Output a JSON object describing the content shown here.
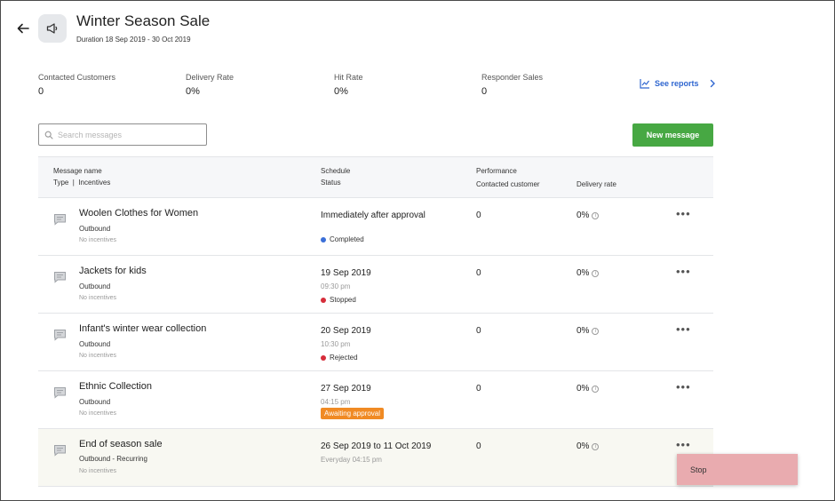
{
  "campaign": {
    "title": "Winter Season Sale",
    "duration": "Duration 18 Sep 2019 - 30 Oct 2019"
  },
  "stats": [
    {
      "label": "Contacted Customers",
      "value": "0"
    },
    {
      "label": "Delivery Rate",
      "value": "0%"
    },
    {
      "label": "Hit Rate",
      "value": "0%"
    },
    {
      "label": "Responder Sales",
      "value": "0"
    }
  ],
  "reports_link": "See reports",
  "search": {
    "placeholder": "Search messages",
    "value": ""
  },
  "new_message_label": "New message",
  "table": {
    "headers": {
      "message_name": "Message name",
      "type_incentives": "Type  |  Incentives",
      "schedule": "Schedule",
      "status": "Status",
      "performance": "Performance",
      "contacted": "Contacted customer",
      "delivery_rate": "Delivery rate"
    },
    "rows": [
      {
        "name": "Woolen Clothes for Women",
        "type": "Outbound",
        "incentives": "No incentives",
        "schedule": "Immediately after approval",
        "time": "",
        "status": "Completed",
        "contacted": "0",
        "rate": "0%"
      },
      {
        "name": "Jackets for kids",
        "type": "Outbound",
        "incentives": "No incentives",
        "schedule": "19 Sep 2019",
        "time": "09:30 pm",
        "status": "Stopped",
        "contacted": "0",
        "rate": "0%"
      },
      {
        "name": "Infant's winter wear collection",
        "type": "Outbound",
        "incentives": "No incentives",
        "schedule": "20 Sep 2019",
        "time": "10:30 pm",
        "status": "Rejected",
        "contacted": "0",
        "rate": "0%"
      },
      {
        "name": "Ethnic Collection",
        "type": "Outbound",
        "incentives": "No incentives",
        "schedule": "27 Sep 2019",
        "time": "04:15 pm",
        "status": "Awaiting approval",
        "contacted": "0",
        "rate": "0%"
      },
      {
        "name": "End of season sale",
        "type": "Outbound - Recurring",
        "incentives": "No incentives",
        "schedule": "26 Sep 2019 to 11 Oct 2019",
        "time": "Everyday 04:15 pm",
        "status": "",
        "contacted": "0",
        "rate": "0%"
      }
    ]
  },
  "more_glyph": "•••",
  "info_glyph": "i",
  "menu": {
    "stop_label": "Stop"
  },
  "colors": {
    "accent_blue": "#2f66d0",
    "primary_green": "#47a843",
    "completed": "#3b6fd8",
    "stopped": "#d62d3a",
    "rejected": "#d62d3a",
    "awaiting": "#f08a24",
    "menu_highlight": "#e9abaf"
  },
  "icons": {
    "back": "arrow-left-icon",
    "campaign": "megaphone-icon",
    "reports": "line-chart-icon",
    "search": "search-icon",
    "message": "chat-bubble-icon",
    "more": "more-horizontal-icon",
    "info": "info-icon"
  }
}
